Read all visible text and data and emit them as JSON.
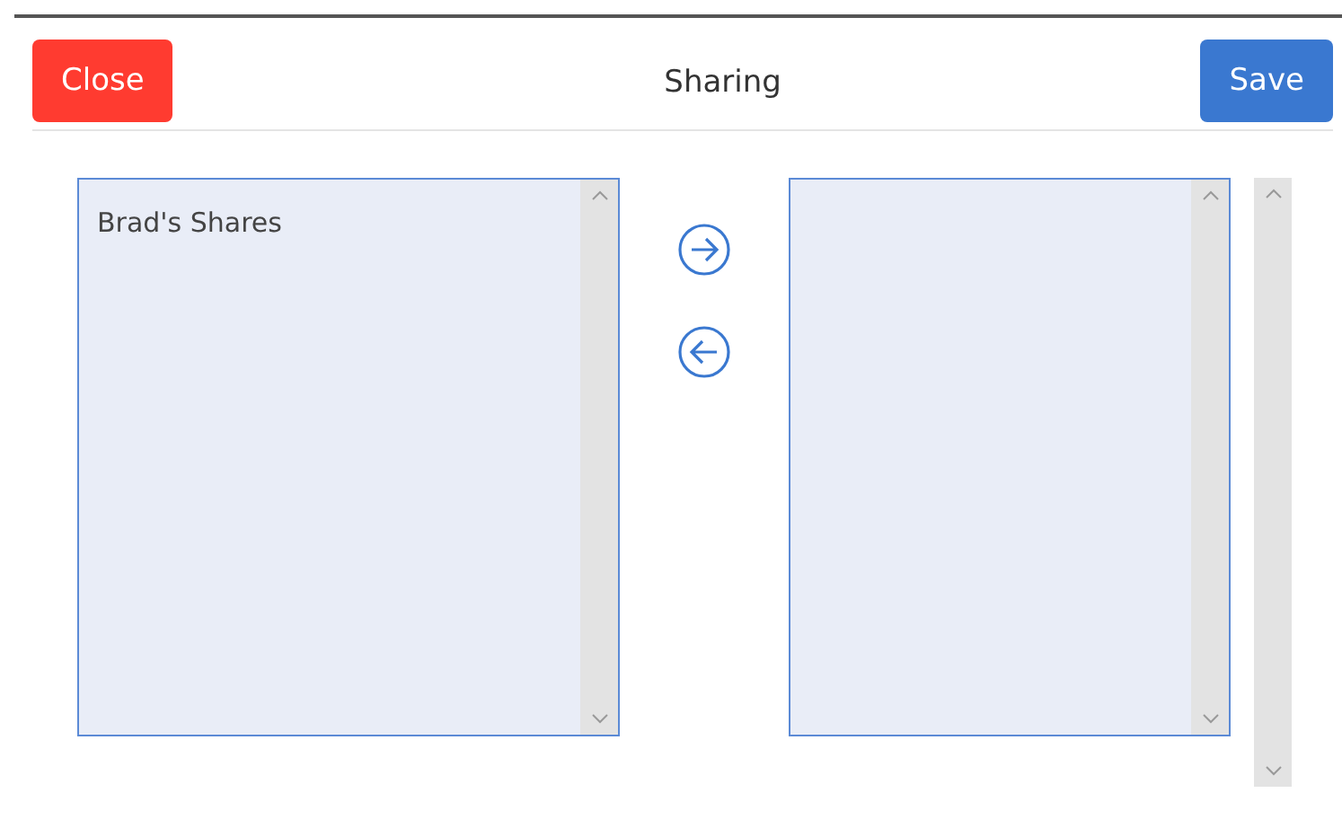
{
  "header": {
    "close_button": "Close",
    "title": "Sharing",
    "save_button": "Save"
  },
  "available_list": {
    "items": [
      "Brad's Shares"
    ]
  }
}
